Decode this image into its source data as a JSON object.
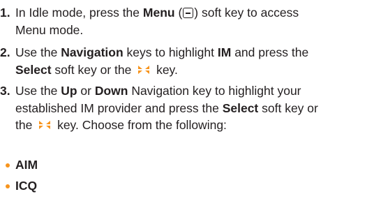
{
  "accent_color": "#f7941d",
  "text_color": "#231f20",
  "steps": [
    {
      "number": "1.",
      "line1_a": "In Idle mode, press the ",
      "bold_menu": "Menu",
      "line1_b": " (",
      "menu_icon": "menu-softkey-icon",
      "line1_c": ") soft key to access",
      "line2": "Menu mode."
    },
    {
      "number": "2.",
      "line1_a": "Use the ",
      "bold_navigation": "Navigation",
      "line1_b": " keys to highlight ",
      "bold_im": "IM",
      "line1_c": " and press the",
      "bold_select": "Select",
      "line2_a": " soft key or the ",
      "nav_icon": "navigation-key-icon",
      "line2_b": " key."
    },
    {
      "number": "3.",
      "line1_a": "Use the ",
      "bold_up": "Up",
      "line1_b": " or ",
      "bold_down": "Down",
      "line1_c": " Navigation key to highlight your",
      "line2_a": "established IM provider and press the ",
      "bold_select": "Select",
      "line2_b": " soft key or",
      "line3_a": "the ",
      "nav_icon": "navigation-key-icon",
      "line3_b": " key. Choose from the following:"
    }
  ],
  "options": [
    {
      "label": "AIM"
    },
    {
      "label": "ICQ"
    }
  ]
}
